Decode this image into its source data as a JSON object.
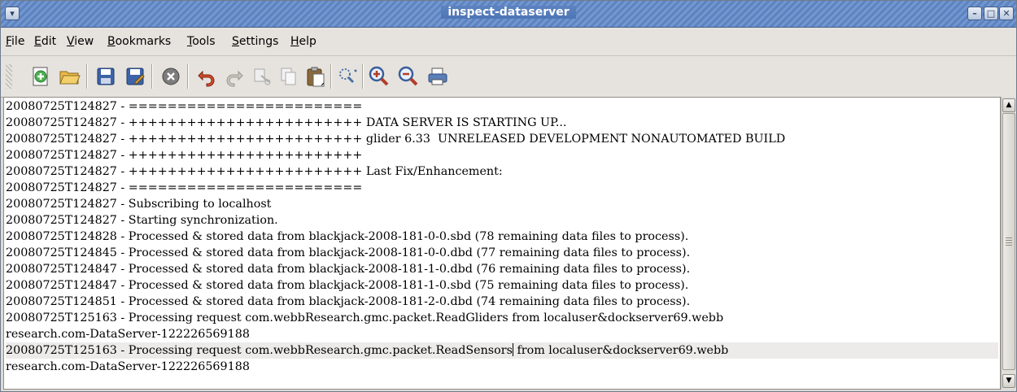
{
  "window": {
    "title": "inspect-dataserver"
  },
  "titlebar_buttons": {
    "menu": "▾",
    "minimize": "–",
    "maximize": "□",
    "close": "✕"
  },
  "menu": [
    {
      "label": "File",
      "accel": "F",
      "rest": "ile"
    },
    {
      "label": "Edit",
      "accel": "E",
      "rest": "dit"
    },
    {
      "label": "View",
      "accel": "V",
      "rest": "iew"
    },
    {
      "label": "Bookmarks",
      "accel": "B",
      "rest": "ookmarks"
    },
    {
      "label": "Tools",
      "accel": "T",
      "rest": "ools"
    },
    {
      "label": "Settings",
      "accel": "S",
      "rest": "ettings"
    },
    {
      "label": "Help",
      "accel": "H",
      "rest": "elp"
    }
  ],
  "toolbar": {
    "icons": [
      "new-document-icon",
      "open-folder-icon",
      "save-icon",
      "save-as-icon",
      "stop-icon",
      "undo-icon",
      "redo-icon",
      "cut-icon",
      "copy-icon",
      "paste-icon",
      "find-icon",
      "zoom-in-icon",
      "zoom-out-icon",
      "print-icon"
    ]
  },
  "log": {
    "lines": [
      "20080725T124827 - ========================",
      "20080725T124827 - ++++++++++++++++++++++++ DATA SERVER IS STARTING UP...",
      "20080725T124827 - ++++++++++++++++++++++++ glider 6.33  UNRELEASED DEVELOPMENT NONAUTOMATED BUILD",
      "20080725T124827 - ++++++++++++++++++++++++",
      "20080725T124827 - ++++++++++++++++++++++++ Last Fix/Enhancement:",
      "20080725T124827 - ========================",
      "20080725T124827 - Subscribing to localhost",
      "20080725T124827 - Starting synchronization.",
      "20080725T124828 - Processed & stored data from blackjack-2008-181-0-0.sbd (78 remaining data files to process).",
      "20080725T124845 - Processed & stored data from blackjack-2008-181-0-0.dbd (77 remaining data files to process).",
      "20080725T124847 - Processed & stored data from blackjack-2008-181-1-0.dbd (76 remaining data files to process).",
      "20080725T124847 - Processed & stored data from blackjack-2008-181-1-0.sbd (75 remaining data files to process).",
      "20080725T124851 - Processed & stored data from blackjack-2008-181-2-0.dbd (74 remaining data files to process).",
      "20080725T125163 - Processing request com.webbResearch.gmc.packet.ReadGliders from localuser&dockserver69.webb",
      "research.com-DataServer-122226569188",
      "20080725T125163 - Processing request com.webbResearch.gmc.packet.ReadSensors",
      "research.com-DataServer-122226569188"
    ],
    "cursor_line_after_caret": " from localuser&dockserver69.webb"
  },
  "scrollbar": {
    "up_arrow": "▲",
    "down_arrow": "▼"
  }
}
